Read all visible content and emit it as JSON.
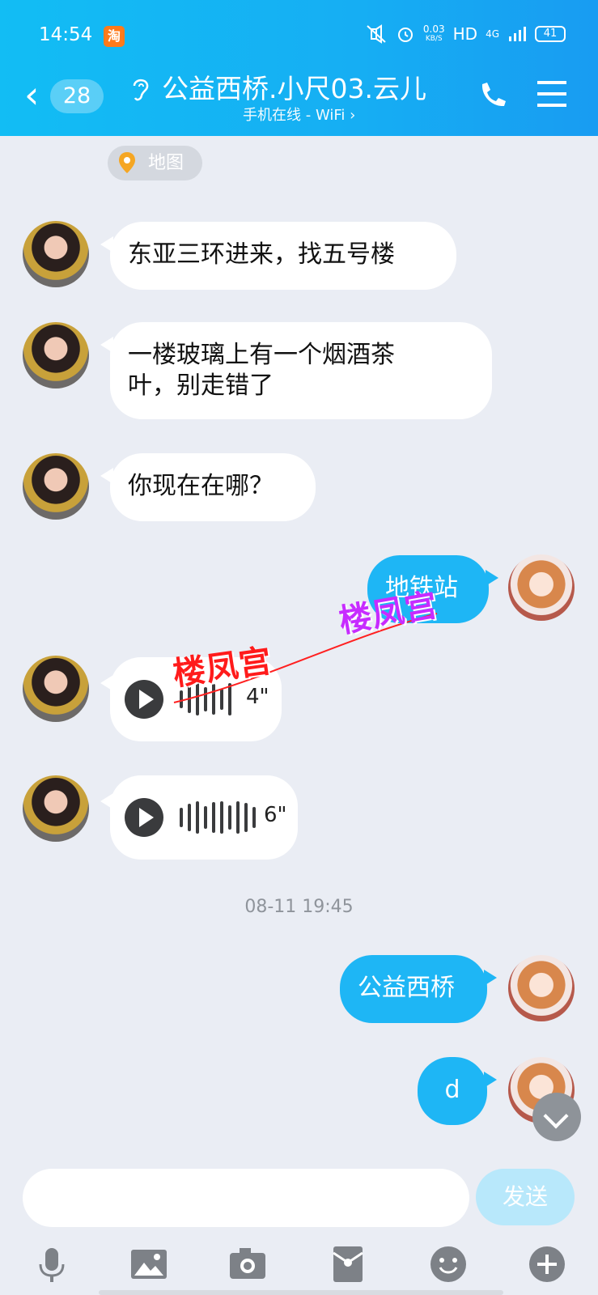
{
  "status_bar": {
    "time": "14:54",
    "app_badge": "淘",
    "net_speed_value": "0.03",
    "net_speed_unit": "KB/S",
    "hd": "HD",
    "network": "4G",
    "battery": "41"
  },
  "header": {
    "unread_count": "28",
    "title": "公益西桥.小尺03.云儿",
    "subtitle": "手机在线 - WiFi ›"
  },
  "map_chip": {
    "label": "地图"
  },
  "messages": [
    {
      "text": "东亚三环进来，找五号楼"
    },
    {
      "text_line1": "一楼玻璃上有一个烟酒茶",
      "text_line2": "叶，别走错了"
    },
    {
      "text": "你现在在哪？"
    },
    {
      "text": "地铁站"
    },
    {
      "duration": "4\""
    },
    {
      "duration": "6\""
    },
    {
      "text": "公益西桥"
    },
    {
      "text": "d"
    }
  ],
  "timestamp": "08-11 19:45",
  "watermarks": [
    "楼凤宫",
    "楼凤宫"
  ],
  "composer": {
    "placeholder": "",
    "send_label": "发送"
  },
  "colors": {
    "header": "#16aef3",
    "my_bubble": "#1eb6f5",
    "background": "#eaedf4"
  },
  "toolbar": {
    "icons": [
      "microphone-icon",
      "image-icon",
      "camera-icon",
      "red-packet-icon",
      "emoji-icon",
      "plus-icon"
    ]
  }
}
